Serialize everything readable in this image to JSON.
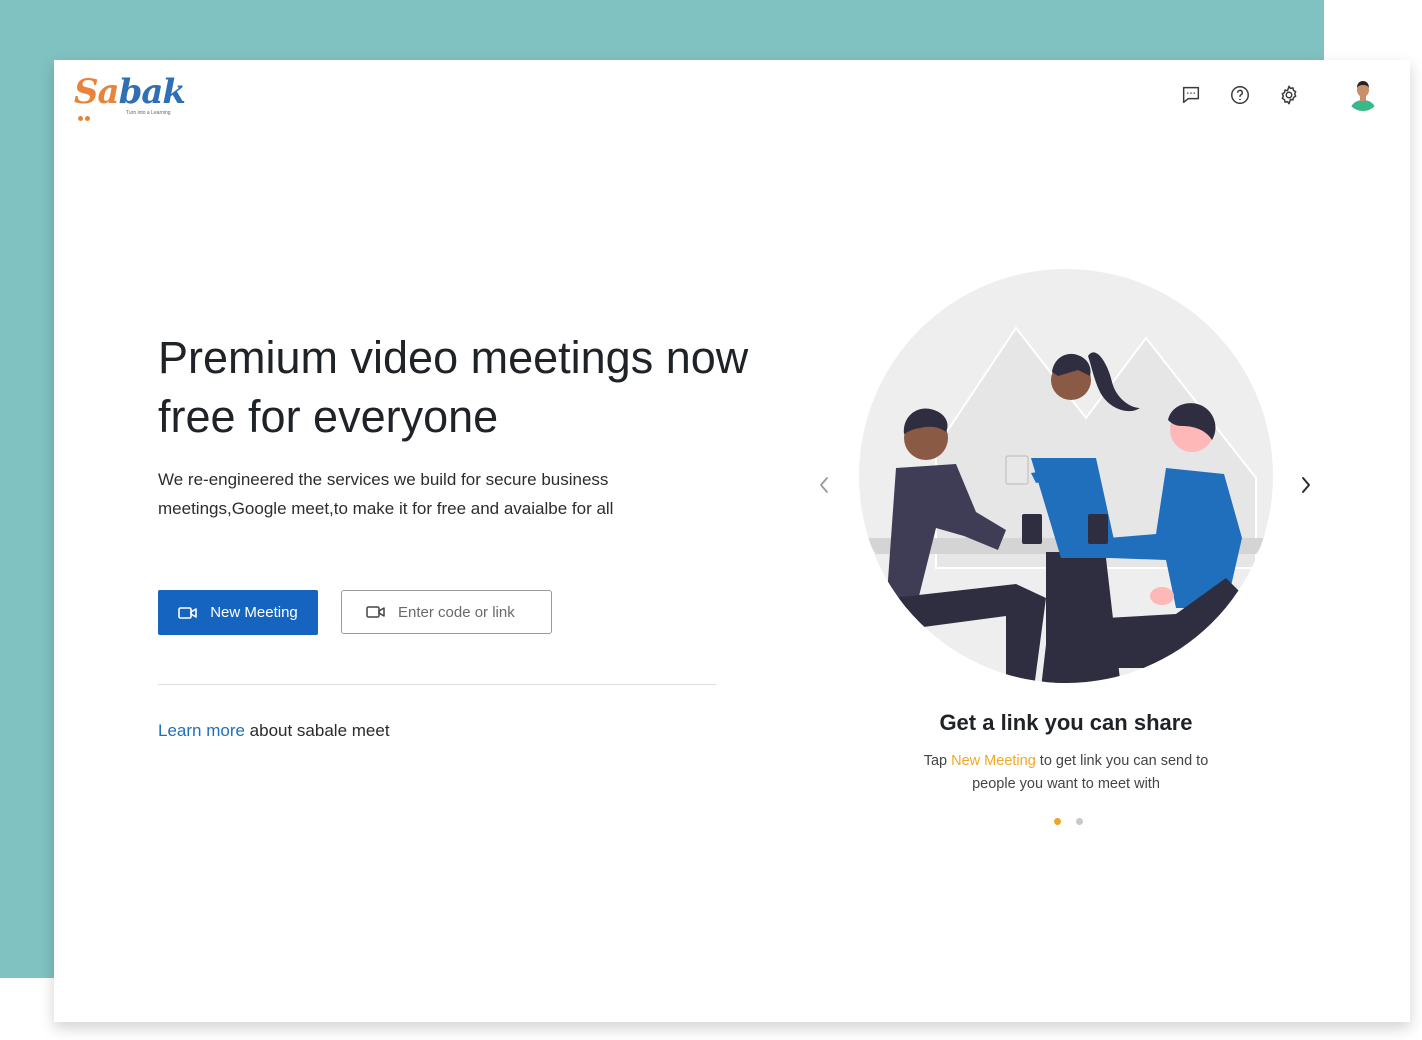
{
  "brand": {
    "logo_text_a": "Sa",
    "logo_text_b": "bak",
    "logo_tagline": "Turn into a Learning"
  },
  "header": {
    "icons": [
      "feedback-icon",
      "help-icon",
      "settings-icon"
    ],
    "avatar_icon": "user-avatar"
  },
  "hero": {
    "title": "Premium video meetings now free for everyone",
    "description": "We re-engineered the services we build for secure business meetings,Google meet,to make it for free and avaialbe for all",
    "new_meeting_label": "New Meeting",
    "code_placeholder": "Enter code or link",
    "learn_more_link": "Learn more",
    "learn_more_rest": " about sabale meet"
  },
  "carousel": {
    "slide_title": "Get a link you can share",
    "desc_prefix": "Tap ",
    "desc_highlight": "New Meeting",
    "desc_suffix": " to get link you can send to people you want to meet with",
    "active_index": 0,
    "total_slides": 2
  },
  "colors": {
    "teal_background": "#80c2c1",
    "primary_blue": "#1565c0",
    "link_blue": "#1f6fc0",
    "accent_orange": "#f0a32a",
    "illustration_blue": "#1f6fbd"
  }
}
